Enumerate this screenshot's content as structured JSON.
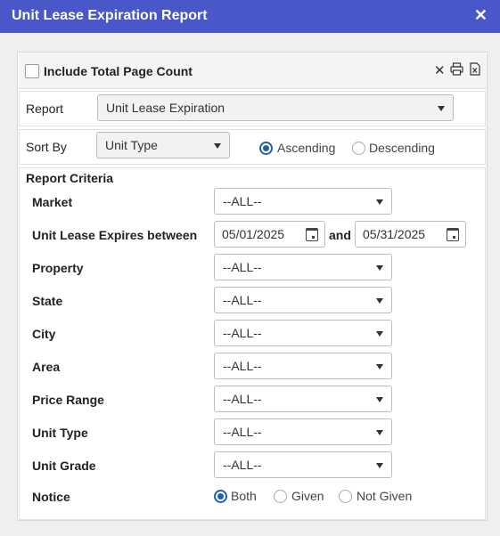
{
  "window": {
    "title": "Unit Lease Expiration Report",
    "close_glyph": "✕"
  },
  "options": {
    "include_total_label": "Include Total Page Count"
  },
  "report": {
    "label": "Report",
    "value": "Unit Lease Expiration"
  },
  "sort": {
    "label": "Sort By",
    "value": "Unit Type",
    "ascending": "Ascending",
    "descending": "Descending"
  },
  "criteria": {
    "header": "Report Criteria",
    "market": {
      "label": "Market",
      "value": "--ALL--"
    },
    "expires": {
      "label": "Unit Lease Expires between",
      "from": "05/01/2025",
      "and": "and",
      "to": "05/31/2025"
    },
    "property": {
      "label": "Property",
      "value": "--ALL--"
    },
    "state": {
      "label": "State",
      "value": "--ALL--"
    },
    "city": {
      "label": "City",
      "value": "--ALL--"
    },
    "area": {
      "label": "Area",
      "value": "--ALL--"
    },
    "price_range": {
      "label": "Price Range",
      "value": "--ALL--"
    },
    "unit_type": {
      "label": "Unit Type",
      "value": "--ALL--"
    },
    "unit_grade": {
      "label": "Unit Grade",
      "value": "--ALL--"
    },
    "notice": {
      "label": "Notice",
      "both": "Both",
      "given": "Given",
      "not_given": "Not Given"
    }
  }
}
